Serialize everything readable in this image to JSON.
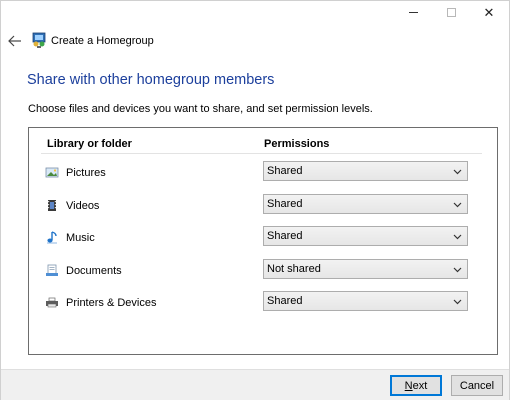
{
  "window": {
    "caption_close": "✕"
  },
  "header": {
    "title": "Create a Homegroup"
  },
  "main": {
    "heading": "Share with other homegroup members",
    "instructions": "Choose files and devices you want to share, and set permission levels.",
    "columns": {
      "library": "Library or folder",
      "permissions": "Permissions"
    },
    "items": [
      {
        "label": "Pictures",
        "permission": "Shared",
        "icon": "pictures-icon"
      },
      {
        "label": "Videos",
        "permission": "Shared",
        "icon": "videos-icon"
      },
      {
        "label": "Music",
        "permission": "Shared",
        "icon": "music-icon"
      },
      {
        "label": "Documents",
        "permission": "Not shared",
        "icon": "documents-icon"
      },
      {
        "label": "Printers & Devices",
        "permission": "Shared",
        "icon": "printers-icon"
      }
    ]
  },
  "footer": {
    "next_accel": "N",
    "next_rest": "ext",
    "cancel_label": "Cancel"
  }
}
